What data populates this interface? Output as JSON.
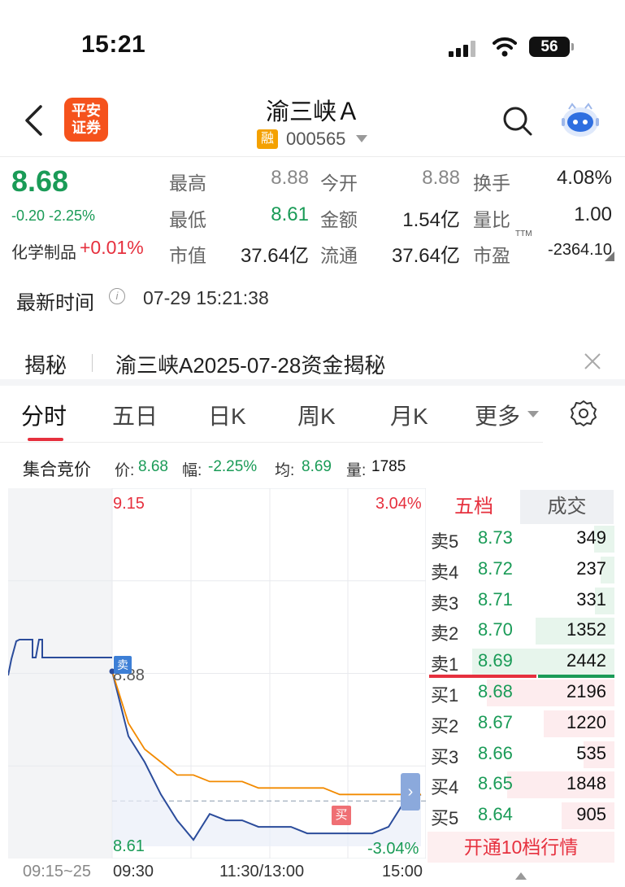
{
  "status_bar": {
    "time": "15:21",
    "battery": "56"
  },
  "header": {
    "logo_line1": "平安",
    "logo_line2": "证券",
    "stock_name": "渝三峡Ａ",
    "badge": "融",
    "code": "000565"
  },
  "quote": {
    "price": "8.68",
    "change": "-0.20  -2.25%",
    "industry_label": "化学制品",
    "industry_change": "+0.01%",
    "stats": [
      {
        "label": "最高",
        "value": "8.88"
      },
      {
        "label": "今开",
        "value": "8.88"
      },
      {
        "label": "换手",
        "value": "4.08%"
      },
      {
        "label": "最低",
        "value": "8.61"
      },
      {
        "label": "金额",
        "value": "1.54亿"
      },
      {
        "label": "量比",
        "value": "1.00"
      },
      {
        "label": "市值",
        "value": "37.64亿"
      },
      {
        "label": "流通",
        "value": "37.64亿"
      },
      {
        "label": "市盈",
        "value": "-2364.10"
      }
    ],
    "pe_superscript": "TTM",
    "update_label": "最新时间",
    "update_icon": "i",
    "update_time": "07-29 15:21:38"
  },
  "reveal": {
    "label": "揭秘",
    "text": "渝三峡A2025-07-28资金揭秘"
  },
  "tabs": [
    "分时",
    "五日",
    "日K",
    "周K",
    "月K",
    "更多"
  ],
  "auction": {
    "label": "集合竞价",
    "price_label": "价:",
    "price": "8.68",
    "range_label": "幅:",
    "range": "-2.25%",
    "avg_label": "均:",
    "avg": "8.69",
    "vol_label": "量:",
    "vol": "1785"
  },
  "chart_labels": {
    "y_top": "9.15",
    "pct_top": "3.04%",
    "y_prev_close": "8.88",
    "y_bottom": "8.61",
    "pct_bottom": "-3.04%",
    "sell_tag": "卖",
    "buy_tag": "买",
    "expand": "›",
    "x_ticks": [
      "09:15~25",
      "09:30",
      "11:30/13:00",
      "15:00"
    ]
  },
  "chart_data": {
    "type": "line",
    "title": "",
    "xlabel": "",
    "ylabel": "",
    "ylim": [
      8.61,
      9.15
    ],
    "prev_close": 8.88,
    "x_ticks": [
      "09:15~25",
      "09:30",
      "11:30/13:00",
      "15:00"
    ],
    "grid": true,
    "series": [
      {
        "color": "#2b4c9b",
        "values": [
          8.88,
          8.78,
          8.74,
          8.69,
          8.65,
          8.62,
          8.66,
          8.65,
          8.65,
          8.64,
          8.64,
          8.64,
          8.63,
          8.63,
          8.63,
          8.63,
          8.63,
          8.64,
          8.68,
          8.69
        ]
      },
      {
        "color": "#f28a00",
        "values": [
          8.88,
          8.8,
          8.76,
          8.74,
          8.72,
          8.72,
          8.71,
          8.71,
          8.71,
          8.7,
          8.7,
          8.7,
          8.7,
          8.7,
          8.69,
          8.69,
          8.69,
          8.69,
          8.69,
          8.69
        ]
      }
    ]
  },
  "order_book": {
    "tab_five": "五档",
    "tab_trades": "成交",
    "rows": [
      {
        "label": "卖5",
        "price": "8.73",
        "vol": "349"
      },
      {
        "label": "卖4",
        "price": "8.72",
        "vol": "237"
      },
      {
        "label": "卖3",
        "price": "8.71",
        "vol": "331"
      },
      {
        "label": "卖2",
        "price": "8.70",
        "vol": "1352"
      },
      {
        "label": "卖1",
        "price": "8.69",
        "vol": "2442"
      },
      {
        "label": "买1",
        "price": "8.68",
        "vol": "2196"
      },
      {
        "label": "买2",
        "price": "8.67",
        "vol": "1220"
      },
      {
        "label": "买3",
        "price": "8.66",
        "vol": "535"
      },
      {
        "label": "买4",
        "price": "8.65",
        "vol": "1848"
      },
      {
        "label": "买5",
        "price": "8.64",
        "vol": "905"
      }
    ],
    "open_ten": "开通10档行情"
  },
  "colors": {
    "up": "#e6303e",
    "down": "#1a9b57",
    "price_line": "#2b4c9b",
    "avg_line": "#f28a00"
  }
}
